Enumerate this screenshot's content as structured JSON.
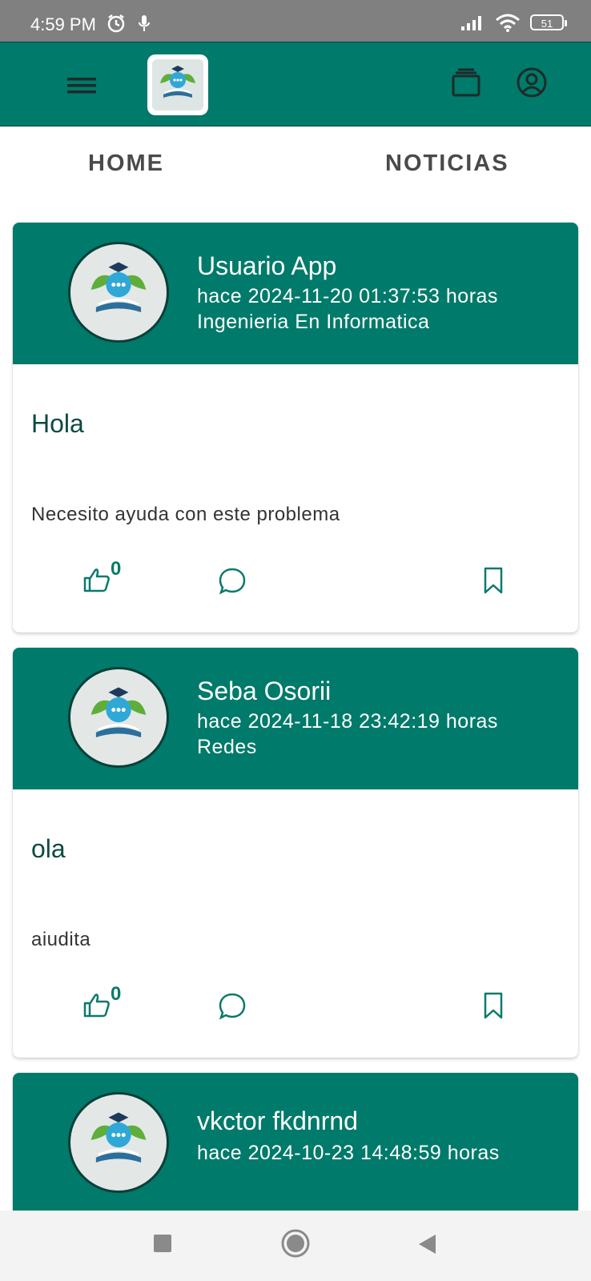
{
  "status_bar": {
    "time": "4:59 PM",
    "battery": "51"
  },
  "tabs": [
    {
      "label": "HOME"
    },
    {
      "label": "NOTICIAS"
    }
  ],
  "posts": [
    {
      "user": "Usuario App",
      "time": "hace 2024-11-20 01:37:53 horas",
      "area": "Ingenieria En Informatica",
      "title": "Hola",
      "text": "Necesito ayuda con este problema",
      "likes": "0"
    },
    {
      "user": "Seba Osorii",
      "time": "hace 2024-11-18 23:42:19 horas",
      "area": "Redes",
      "title": "ola",
      "text": "aiudita",
      "likes": "0"
    },
    {
      "user": "vkctor fkdnrnd",
      "time": "hace 2024-10-23 14:48:59 horas"
    }
  ],
  "colors": {
    "primary": "#007a6a",
    "status_bar": "#808080",
    "text_dark": "#0d4a40"
  },
  "icons": [
    "menu-icon",
    "app-logo",
    "cards-icon",
    "account-icon",
    "thumb-up-icon",
    "comment-icon",
    "bookmark-icon"
  ]
}
